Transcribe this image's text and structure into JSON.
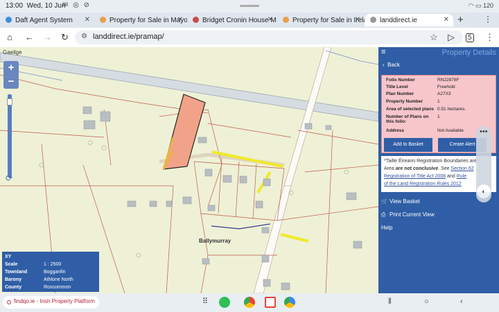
{
  "status_bar": {
    "time": "13:00",
    "date": "Wed, 10 Jun",
    "battery": "120"
  },
  "tabs": [
    {
      "label": "Daft Agent System",
      "color": "#3a8dde"
    },
    {
      "label": "Property for Sale in Mayo",
      "color": "#e8a04a"
    },
    {
      "label": "Bridget Cronin House M",
      "color": "#c94a4a"
    },
    {
      "label": "Property for Sale in Irela",
      "color": "#e8a04a"
    },
    {
      "label": "landdirect.ie",
      "color": "#888888"
    }
  ],
  "address_bar": {
    "url": "landdirect.ie/pramap/"
  },
  "map": {
    "language_link": "Gaeilge",
    "zoom_in": "+",
    "zoom_out": "−",
    "place_label": "Ballymurray",
    "info": {
      "title": "XY",
      "rows": [
        {
          "key": "Scale",
          "value": "1 : 2500"
        },
        {
          "key": "Townland",
          "value": "Bogganfin"
        },
        {
          "key": "Barony",
          "value": "Athlone North"
        },
        {
          "key": "County",
          "value": "Roscommon"
        }
      ]
    }
  },
  "panel": {
    "title": "Property Details",
    "back_label": "Back",
    "details": [
      {
        "key": "Folio Number",
        "value": "RN22878F"
      },
      {
        "key": "Title Level",
        "value": "Freehold"
      },
      {
        "key": "Plan Number",
        "value": "A27X3"
      },
      {
        "key": "Property Number",
        "value": "1"
      },
      {
        "key": "Area of selected plans",
        "value": "0.51 hectares."
      },
      {
        "key": "Number of Plans on this folio:",
        "value": "1"
      },
      {
        "key": "Address",
        "value": "Not Available"
      }
    ],
    "add_to_basket": "Add to Basket",
    "create_alert": "Create Alert",
    "disclaimer": {
      "lead": "*Tailte Éireann Registration Boundaries are",
      "line2a": "Area",
      "line2b": "are not conclusive",
      "line2c": ". See",
      "link1": "Section 62",
      "link2": "Registration of Title Act 2006",
      "line3b": "and",
      "link3": "Rule",
      "link4": "of the Land Registration Rules 2012"
    },
    "view_basket": "View Basket",
    "print_view": "Print Current View",
    "help": "Help"
  },
  "bottom_bar": {
    "site_chip": "findqo.ie - Irish Property Platform"
  }
}
